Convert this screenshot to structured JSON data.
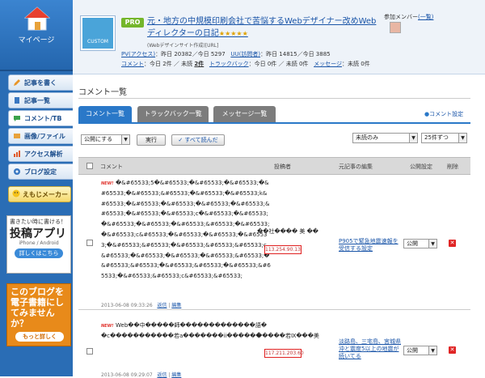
{
  "sidebar": {
    "mypage_label": "マイページ",
    "items": [
      {
        "label": "記事を書く",
        "icon": "pencil-icon"
      },
      {
        "label": "記事一覧",
        "icon": "document-icon"
      },
      {
        "label": "コメント/TB",
        "icon": "speech-bubble-icon"
      },
      {
        "label": "画像/ファイル",
        "icon": "image-icon"
      },
      {
        "label": "アクセス解析",
        "icon": "bar-chart-icon"
      },
      {
        "label": "ブログ設定",
        "icon": "gear-icon"
      }
    ],
    "emoji_maker": "えもじメーカー",
    "ad1": {
      "line1": "書きたい時に書ける！",
      "line2": "投稿アプリ",
      "line3": "iPhone / Android",
      "button": "詳しくはこちら"
    },
    "ad2": {
      "text": "このブログを電子書籍にしてみませんか？",
      "button": "もっと詳しく"
    }
  },
  "header": {
    "icon_label": "CUSTOM",
    "badge": "PRO",
    "title": "元・地方の中規模印刷会社で苦悩するWebデザイナー改めWebディレクターの日記",
    "stars": "★★★★★",
    "subtitle": "(Webデザインサイト作成)[URL]",
    "stats": {
      "pv_label": "PV(アクセス)",
      "pv_yesterday": "：昨日 20382",
      "pv_today": "／今日 5297",
      "uu_label": "UU(訪問者)",
      "uu_yesterday": "：昨日 14815",
      "uu_today": "／今日 3885",
      "comment_label": "コメント",
      "comment_today": "：今日 2件",
      "comment_unread_label": " ／ 未読 ",
      "comment_unread": "2件",
      "trackback_label": "トラックバック",
      "trackback_today": "：今日 0件",
      "trackback_unread": " ／ 未読 0件",
      "message_label": "メッセージ",
      "message_unread": "：未読 0件"
    },
    "members_label": "参加メンバー",
    "members_link": "(一覧)"
  },
  "main": {
    "page_title": "コメント一覧",
    "tabs": [
      {
        "label": "コメント一覧",
        "active": true
      },
      {
        "label": "トラックバック一覧",
        "active": false
      },
      {
        "label": "メッセージ一覧",
        "active": false
      }
    ],
    "comment_settings": "コメント設定",
    "toolbar": {
      "action_select": "公開にする",
      "run_button": "実行",
      "read_all_button": "すべて読んだ",
      "filter_select": "未読のみ",
      "per_page_select": "25件ずつ"
    },
    "columns": {
      "comment": "コメント",
      "author": "投稿者",
      "article": "元記事の編集",
      "publish": "公開設定",
      "delete": "削除"
    },
    "rows": [
      {
        "new_badge": "NEW!",
        "text": "�&#65533;5�&#65533;�&#65533;�&#65533;�&#65533;�&#65533;&#65533;�&#65533;�&#65533;k&#65533;�&#65533;�&#65533;�&#65533;�&#65533;&#65533;�&#65533;�&#65533;c�&#65533;�&#65533;�&#65533;�&#65533;�&#65533;&#65533;�&#65533;�&#65533;c&#65533;�&#65533;�&#65533;�&#65533;�&#65533;&#65533;�&#65533;&#65533;&#65533;c&#65533;�&#65533;�&#65533;�&#65533;&#65533;�&#65533;&#65533;�&#65533;&#65533;�&#65533;&#65533;�&#65533;&#65533;c&#65533;&#65533;",
        "timestamp": "2013-06-08 09:33:26",
        "actions": [
          "返信",
          "編集"
        ],
        "author": "��社���� 美 ��",
        "ip": "113.254.90.13",
        "article": "P905で緊急地震速報を受信する設定",
        "publish": "公開"
      },
      {
        "new_badge": "NEW!",
        "text": "Web��中�����師�������������語��c�����������若a�������ii������",
        "timestamp": "2013-06-08 09:29:07",
        "actions": [
          "返信",
          "編集"
        ],
        "author": "�����若Ⅸ���美",
        "ip": "117.211.203.60",
        "article": "淡路島、三宅島、宮城県沖と震度5以上の地震が続いてる",
        "publish": "公開"
      }
    ]
  },
  "colors": {
    "sidebar_blue": "#2a6db5",
    "tab_active": "#2a78c8",
    "tab_inactive": "#7c7c7c",
    "link": "#1a55a8",
    "pro_green": "#74b62a",
    "highlight_red": "#e02020"
  }
}
